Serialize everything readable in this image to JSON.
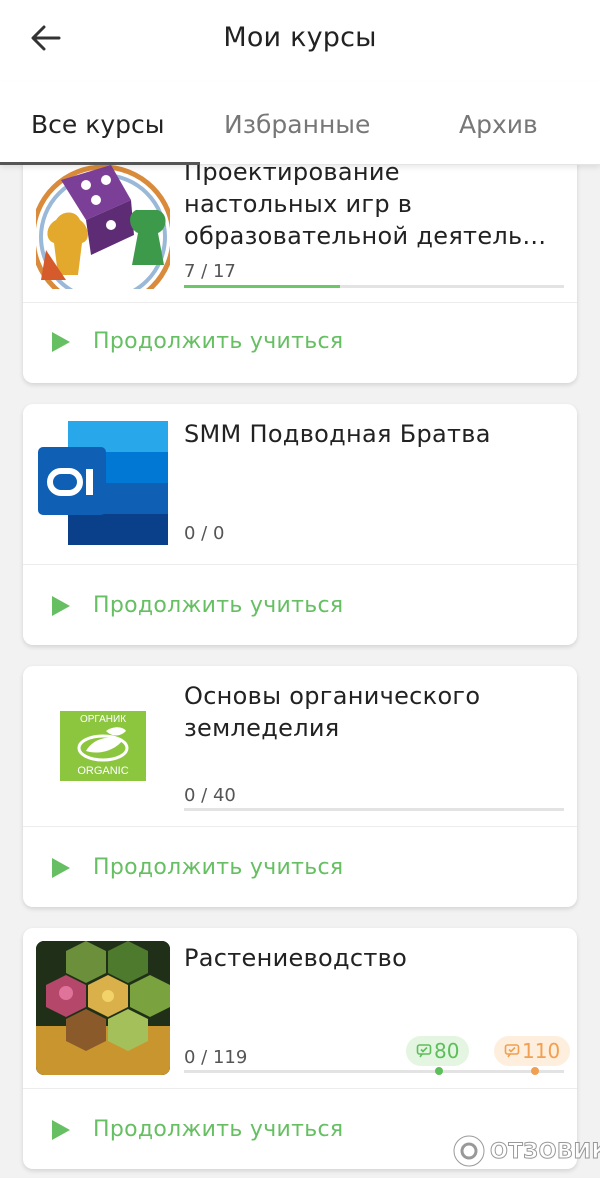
{
  "header": {
    "title": "Мои курсы",
    "back_icon": "arrow-left-icon"
  },
  "tabs": [
    {
      "label": "Все курсы",
      "active": true
    },
    {
      "label": "Избранные",
      "active": false
    },
    {
      "label": "Архив",
      "active": false
    }
  ],
  "courses": [
    {
      "title_lines": [
        "Проектирование",
        "настольных игр в",
        "образовательной деятель..."
      ],
      "progress_text": "7 / 17",
      "progress_fraction": 0.41,
      "image": "board-game-dice-pawns-image",
      "continue_label": "Продолжить учиться"
    },
    {
      "title_lines": [
        "SMM Подводная Братва"
      ],
      "progress_text": "0 / 0",
      "progress_fraction": 0,
      "image": "outlook-logo-image",
      "continue_label": "Продолжить учиться"
    },
    {
      "title_lines": [
        "Основы органического",
        "земледелия"
      ],
      "progress_text": "0 / 40",
      "progress_fraction": 0,
      "image": "organic-logo-image",
      "image_text_top": "ОРГАНИК",
      "image_text_bottom": "ORGANIC",
      "continue_label": "Продолжить учиться"
    },
    {
      "title_lines": [
        "Растениеводство"
      ],
      "progress_text": "0 / 119",
      "progress_fraction": 0,
      "image": "plants-hexagon-collage-image",
      "badges": [
        {
          "text": "80",
          "color": "#5cbf5a",
          "bg": "#e4f5e1"
        },
        {
          "text": "110",
          "color": "#f0a050",
          "bg": "#fdeedd"
        }
      ],
      "continue_label": "Продолжить учиться"
    }
  ],
  "watermark": "ОТЗОВИК",
  "colors": {
    "accent_green": "#66bf62",
    "progress_green": "#6cc767",
    "orange": "#f0a050"
  }
}
